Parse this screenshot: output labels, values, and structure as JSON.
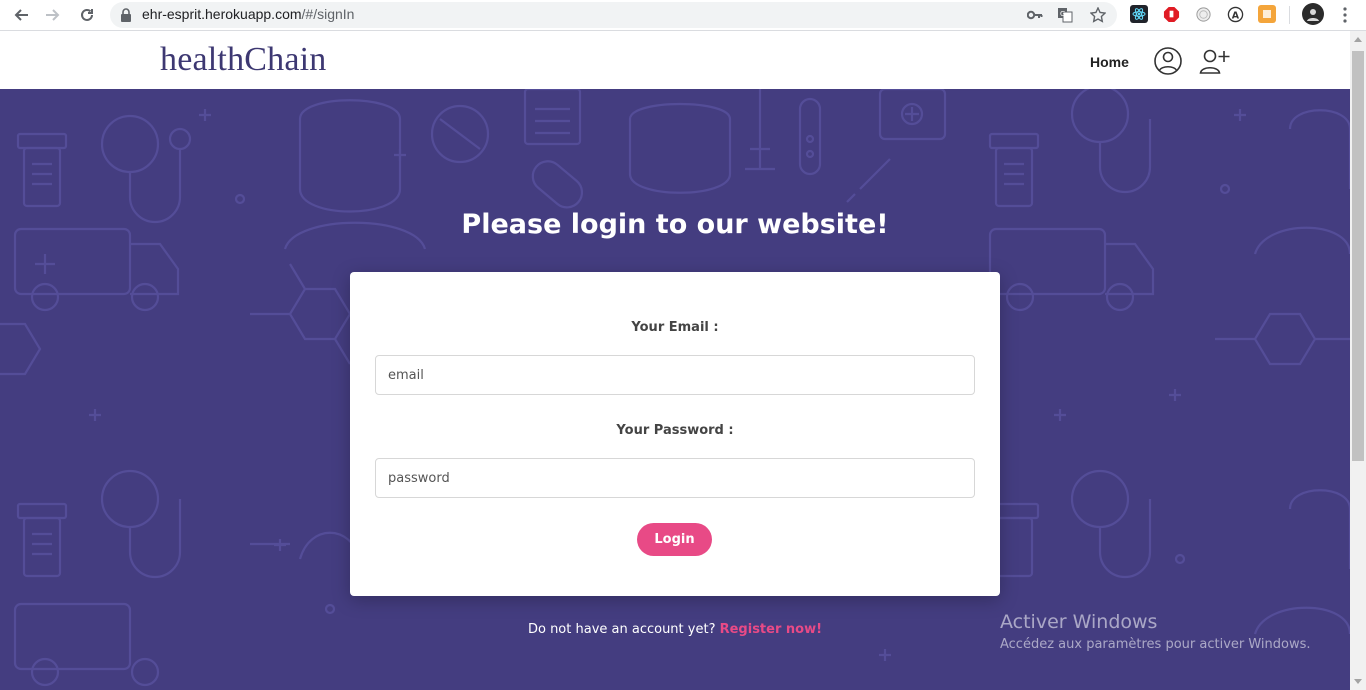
{
  "browser": {
    "url_host": "ehr-esprit.herokuapp.com",
    "url_path": "/#/signIn",
    "extensions": [
      "react-devtools-icon",
      "adblock-icon",
      "clock-icon",
      "a-circle-icon",
      "orange-extension-icon",
      "profile-avatar-icon"
    ]
  },
  "header": {
    "brand": "healthChain",
    "nav": {
      "home": "Home"
    }
  },
  "login": {
    "title": "Please login to our website!",
    "email_label": "Your Email :",
    "email_placeholder": "email",
    "password_label": "Your Password :",
    "password_placeholder": "password",
    "submit": "Login"
  },
  "footer": {
    "prompt": "Do not have an account yet?",
    "register_link": "Register now!"
  },
  "windows_watermark": {
    "title": "Activer Windows",
    "subtitle": "Accédez aux paramètres pour activer Windows."
  },
  "colors": {
    "brand": "#3d3872",
    "hero_bg": "#443d80",
    "accent": "#e84a86"
  }
}
